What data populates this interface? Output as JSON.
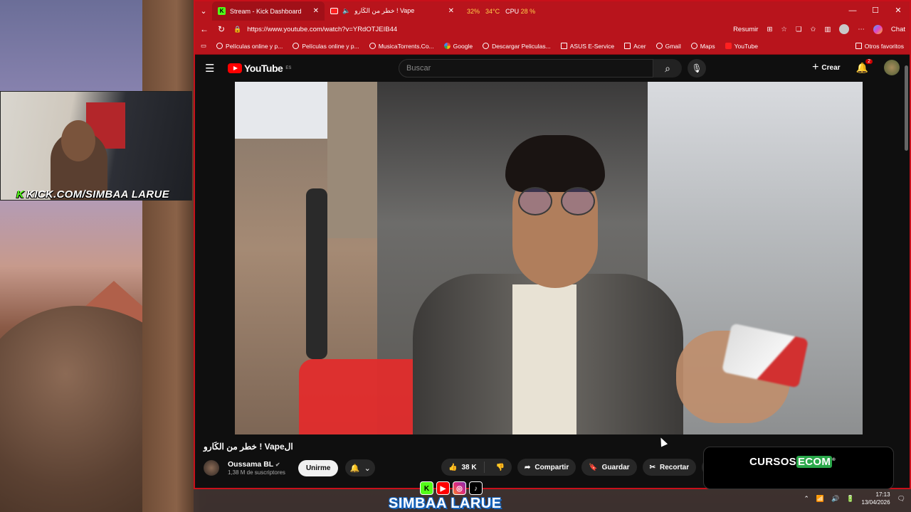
{
  "webcam": {
    "kick_logo": "K",
    "caption": "KICK.COM/SIMBAA LARUE"
  },
  "browser": {
    "tabs": [
      {
        "title": "Stream - Kick Dashboard",
        "icon": "kick-icon"
      },
      {
        "title": "خطر من الكَارو ! Vape",
        "icon": "youtube-icon"
      }
    ],
    "stats": {
      "gpu": "32%",
      "temp": "34°C",
      "cpu_label": "CPU",
      "cpu_value": "28 %"
    },
    "url": "https://www.youtube.com/watch?v=YRdOTJEIB44",
    "resumir": "Resumir",
    "chat": "Chat",
    "bookmarks": [
      "Películas online y p...",
      "Películas online y p...",
      "MusicaTorrents.Co...",
      "Google",
      "Descargar Peliculas...",
      "ASUS E-Service",
      "Acer",
      "Gmail",
      "Maps",
      "YouTube"
    ],
    "favorites_label": "Otros favoritos"
  },
  "youtube": {
    "logo_text": "YouTube",
    "logo_region": "ES",
    "search_placeholder": "Buscar",
    "create_label": "Crear",
    "notification_count": "2",
    "video_title": "خطر من الكَارو ! Vapeال",
    "channel_name": "Oussama BL",
    "subscribers": "1,38 M de suscriptores",
    "join_label": "Unirme",
    "likes": "38 K",
    "share_label": "Compartir",
    "save_label": "Guardar",
    "clip_label": "Recortar",
    "ad_brand_a": "CURSOS",
    "ad_brand_b": "ECOM"
  },
  "taskbar": {
    "time": "17:13",
    "date": "13/04/2026"
  },
  "overlay": {
    "streamer_name": "SIMBAA LARUE"
  },
  "colors": {
    "browser_accent": "#b8141c",
    "kick_green": "#53fc18",
    "yt_red": "#ff0000"
  }
}
